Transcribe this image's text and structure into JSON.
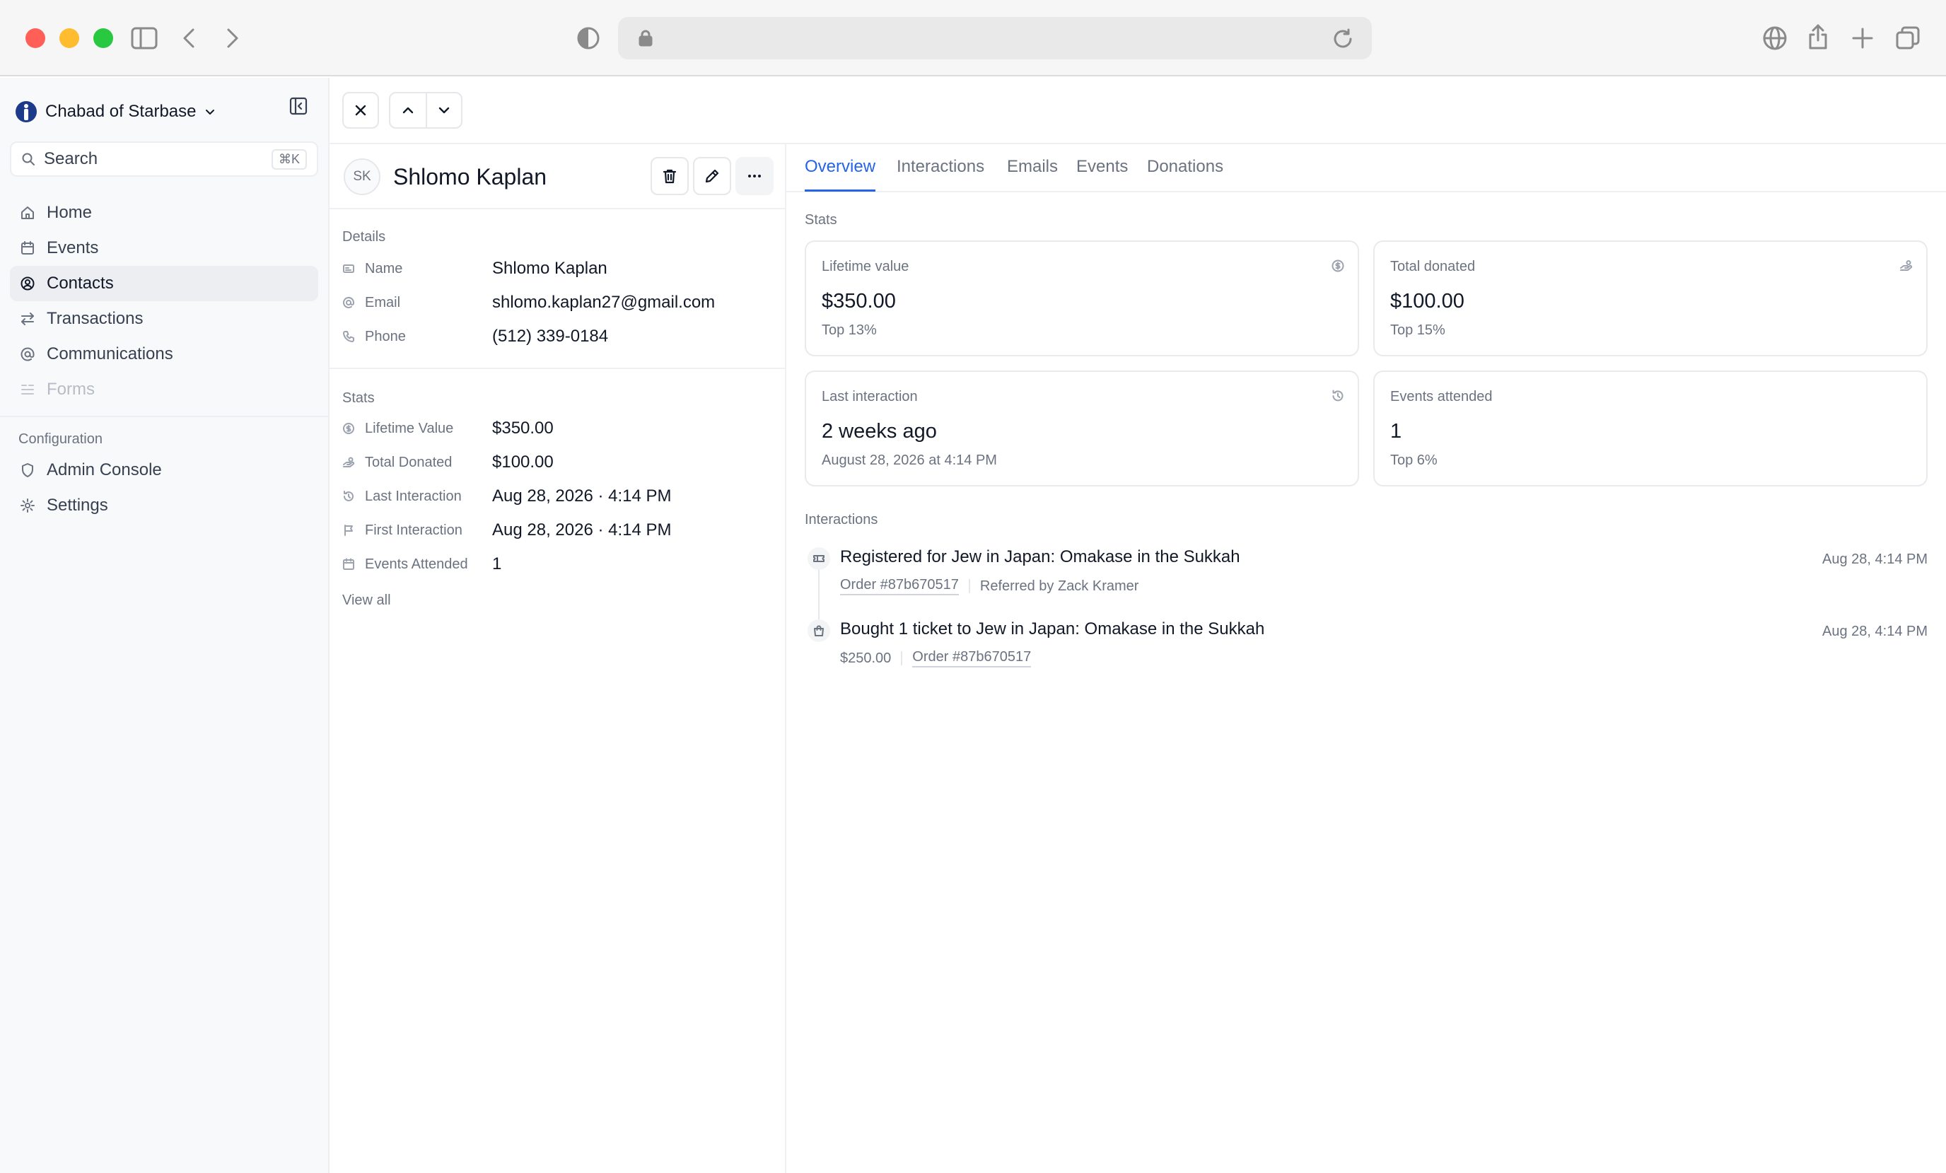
{
  "browser": {},
  "sidebar": {
    "org_name": "Chabad of Starbase",
    "search_placeholder": "Search",
    "search_shortcut": "⌘K",
    "nav": [
      {
        "label": "Home",
        "icon": "home-icon"
      },
      {
        "label": "Events",
        "icon": "calendar-icon"
      },
      {
        "label": "Contacts",
        "icon": "user-circle-icon",
        "active": true
      },
      {
        "label": "Transactions",
        "icon": "arrows-exchange-icon"
      },
      {
        "label": "Communications",
        "icon": "at-sign-icon"
      },
      {
        "label": "Forms",
        "icon": "form-icon",
        "disabled": true
      }
    ],
    "config_label": "Configuration",
    "config_nav": [
      {
        "label": "Admin Console",
        "icon": "shield-icon"
      },
      {
        "label": "Settings",
        "icon": "gear-icon"
      }
    ]
  },
  "contact": {
    "initials": "SK",
    "name": "Shlomo Kaplan",
    "details_label": "Details",
    "details": [
      {
        "key": "Name",
        "value": "Shlomo Kaplan",
        "icon": "id-card-icon"
      },
      {
        "key": "Email",
        "value": "shlomo.kaplan27@gmail.com",
        "icon": "at-sign-icon"
      },
      {
        "key": "Phone",
        "value": "(512) 339-0184",
        "icon": "phone-icon"
      }
    ],
    "stats_label": "Stats",
    "stats": [
      {
        "key": "Lifetime Value",
        "value": "$350.00",
        "icon": "dollar-circle-icon"
      },
      {
        "key": "Total Donated",
        "value": "$100.00",
        "icon": "hand-coins-icon"
      },
      {
        "key": "Last Interaction",
        "value": "Aug 28, 2026 · 4:14 PM",
        "icon": "history-icon"
      },
      {
        "key": "First Interaction",
        "value": "Aug 28, 2026 · 4:14 PM",
        "icon": "flag-icon"
      },
      {
        "key": "Events Attended",
        "value": "1",
        "icon": "calendar-icon"
      }
    ],
    "view_all": "View all"
  },
  "tabs": [
    "Overview",
    "Interactions",
    "Emails",
    "Events",
    "Donations"
  ],
  "overview": {
    "stats_label": "Stats",
    "cards": [
      {
        "label": "Lifetime value",
        "value": "$350.00",
        "sub": "Top 13%",
        "icon": "dollar-circle-icon"
      },
      {
        "label": "Total donated",
        "value": "$100.00",
        "sub": "Top 15%",
        "icon": "hand-coins-icon"
      },
      {
        "label": "Last interaction",
        "value": "2 weeks ago",
        "sub": "August 28, 2026 at 4:14 PM",
        "icon": "history-icon"
      },
      {
        "label": "Events attended",
        "value": "1",
        "sub": "Top 6%",
        "icon": ""
      }
    ],
    "interactions_label": "Interactions",
    "interactions": [
      {
        "title": "Registered for Jew in Japan: Omakase in the Sukkah",
        "meta1": "Order #87b670517",
        "meta2": "Referred by Zack Kramer",
        "time": "Aug 28, 4:14 PM",
        "icon": "ticket-icon"
      },
      {
        "title": "Bought 1 ticket to Jew in Japan: Omakase in the Sukkah",
        "meta1": "$250.00",
        "meta2": "Order #87b670517",
        "time": "Aug 28, 4:14 PM",
        "icon": "shopping-bag-icon"
      }
    ]
  }
}
